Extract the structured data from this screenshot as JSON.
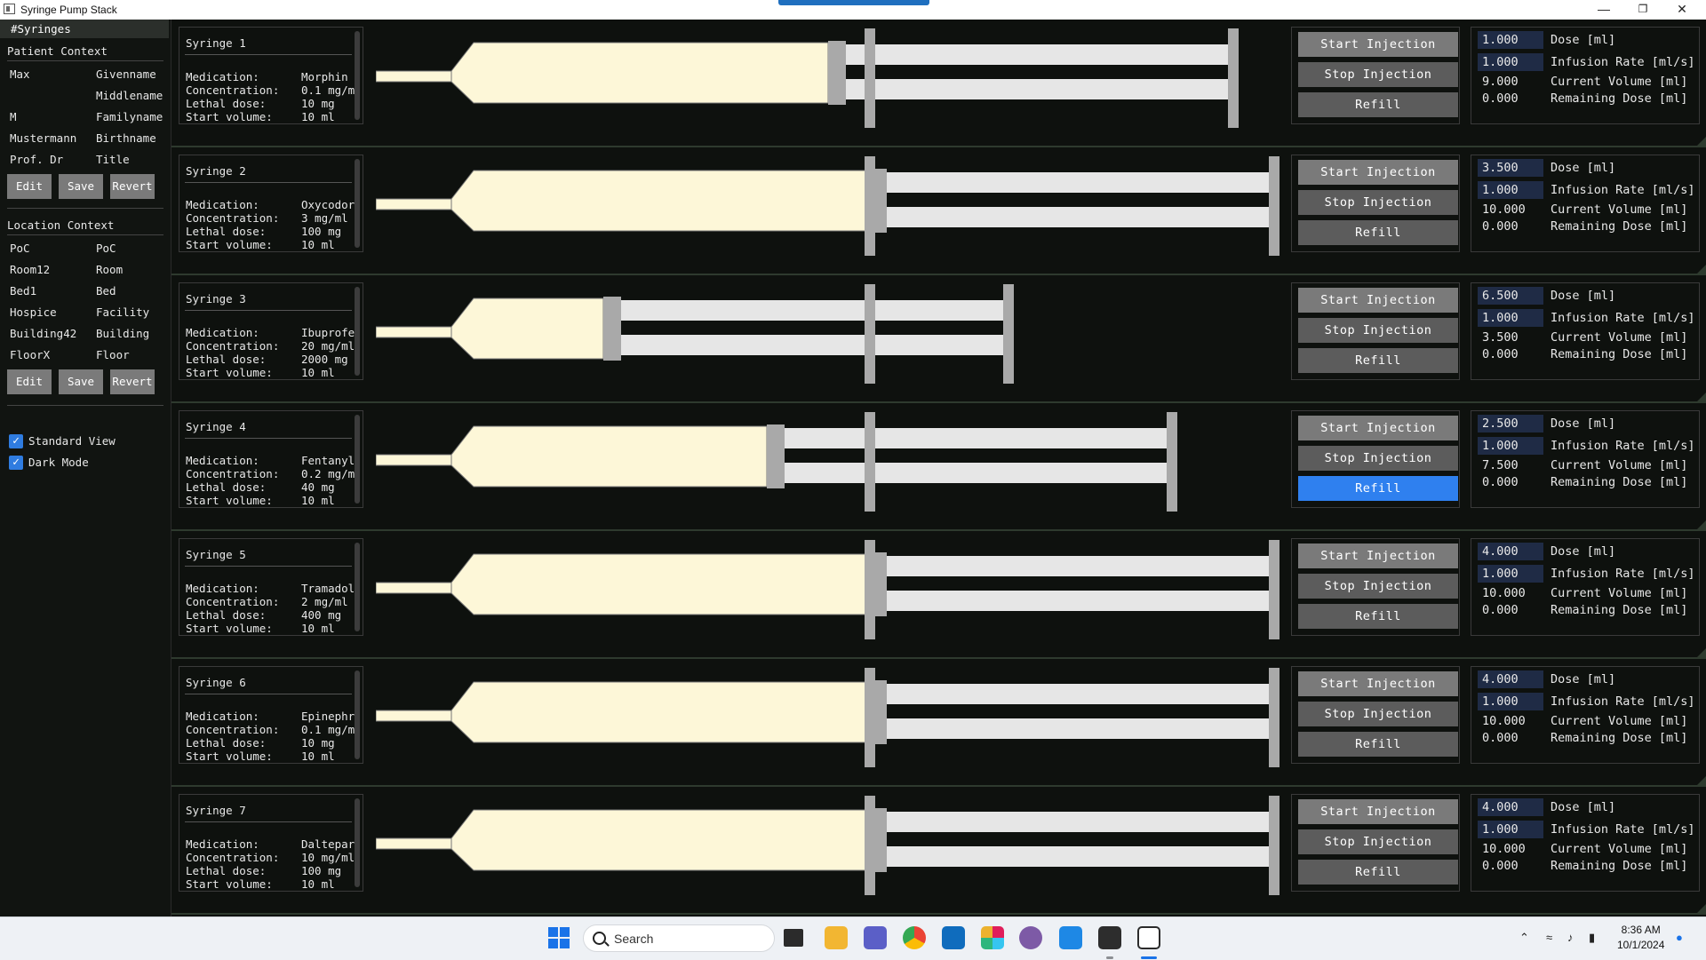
{
  "window": {
    "title": "Syringe Pump Stack"
  },
  "sidebar": {
    "tab": "#Syringes",
    "patient": {
      "title": "Patient Context",
      "fields": [
        {
          "value": "Max",
          "label": "Givenname"
        },
        {
          "value": "",
          "label": "Middlename"
        },
        {
          "value": "M",
          "label": "Familyname"
        },
        {
          "value": "Mustermann",
          "label": "Birthname"
        },
        {
          "value": "Prof. Dr",
          "label": "Title"
        }
      ],
      "buttons": {
        "edit": "Edit",
        "save": "Save",
        "revert": "Revert"
      }
    },
    "location": {
      "title": "Location Context",
      "fields": [
        {
          "value": "PoC",
          "label": "PoC"
        },
        {
          "value": "Room12",
          "label": "Room"
        },
        {
          "value": "Bed1",
          "label": "Bed"
        },
        {
          "value": "Hospice",
          "label": "Facility"
        },
        {
          "value": "Building42",
          "label": "Building"
        },
        {
          "value": "FloorX",
          "label": "Floor"
        }
      ],
      "buttons": {
        "edit": "Edit",
        "save": "Save",
        "revert": "Revert"
      }
    },
    "options": [
      {
        "label": "Standard View",
        "checked": true
      },
      {
        "label": "Dark Mode",
        "checked": true
      }
    ]
  },
  "labels": {
    "medication": "Medication:",
    "concentration": "Concentration:",
    "lethal": "Lethal dose:",
    "start_volume": "Start volume:",
    "start": "Start Injection",
    "stop": "Stop Injection",
    "refill": "Refill",
    "dose": "Dose [ml]",
    "rate": "Infusion Rate [ml/s]",
    "current": "Current Volume [ml]",
    "remaining": "Remaining Dose [ml]"
  },
  "syringes": [
    {
      "name": "Syringe 1",
      "medication": "Morphin",
      "concentration": "0.1 mg/m",
      "lethal": "10 mg",
      "start_volume": "10 ml",
      "dose": "1.000",
      "rate": "1.000",
      "current": "9.000",
      "remaining": "0.000",
      "fill_fraction": 0.9,
      "refill_active": false
    },
    {
      "name": "Syringe 2",
      "medication": "Oxycodor",
      "concentration": "3 mg/ml",
      "lethal": "100 mg",
      "start_volume": "10 ml",
      "dose": "3.500",
      "rate": "1.000",
      "current": "10.000",
      "remaining": "0.000",
      "fill_fraction": 1.0,
      "refill_active": false
    },
    {
      "name": "Syringe 3",
      "medication": "Ibuprofe",
      "concentration": "20 mg/ml",
      "lethal": "2000 mg",
      "start_volume": "10 ml",
      "dose": "6.500",
      "rate": "1.000",
      "current": "3.500",
      "remaining": "0.000",
      "fill_fraction": 0.35,
      "refill_active": false
    },
    {
      "name": "Syringe 4",
      "medication": "Fentanyl",
      "concentration": "0.2 mg/m",
      "lethal": "40 mg",
      "start_volume": "10 ml",
      "dose": "2.500",
      "rate": "1.000",
      "current": "7.500",
      "remaining": "0.000",
      "fill_fraction": 0.75,
      "refill_active": true
    },
    {
      "name": "Syringe 5",
      "medication": "Tramadol",
      "concentration": "2 mg/ml",
      "lethal": "400 mg",
      "start_volume": "10 ml",
      "dose": "4.000",
      "rate": "1.000",
      "current": "10.000",
      "remaining": "0.000",
      "fill_fraction": 1.0,
      "refill_active": false
    },
    {
      "name": "Syringe 6",
      "medication": "Epinephr",
      "concentration": "0.1 mg/m",
      "lethal": "10 mg",
      "start_volume": "10 ml",
      "dose": "4.000",
      "rate": "1.000",
      "current": "10.000",
      "remaining": "0.000",
      "fill_fraction": 1.0,
      "refill_active": false
    },
    {
      "name": "Syringe 7",
      "medication": "Daltepar",
      "concentration": "10 mg/ml",
      "lethal": "100 mg",
      "start_volume": "10 ml",
      "dose": "4.000",
      "rate": "1.000",
      "current": "10.000",
      "remaining": "0.000",
      "fill_fraction": 1.0,
      "refill_active": false
    }
  ],
  "taskbar": {
    "search_placeholder": "Search",
    "time": "8:36 AM",
    "date": "10/1/2024",
    "icons": [
      "windows-start-icon",
      "search-icon",
      "task-view-icon",
      "file-explorer-icon",
      "teams-icon",
      "chrome-icon",
      "outlook-icon",
      "slack-icon",
      "app-icon",
      "vscode-icon",
      "terminal-icon",
      "syringe-app-icon"
    ]
  },
  "colors": {
    "fluid": "#fdf7d8",
    "barrel": "#e6e6e6",
    "plunger": "#a9a9a9",
    "accent_blue": "#2f80ef",
    "panel_bg": "#0e110e"
  }
}
